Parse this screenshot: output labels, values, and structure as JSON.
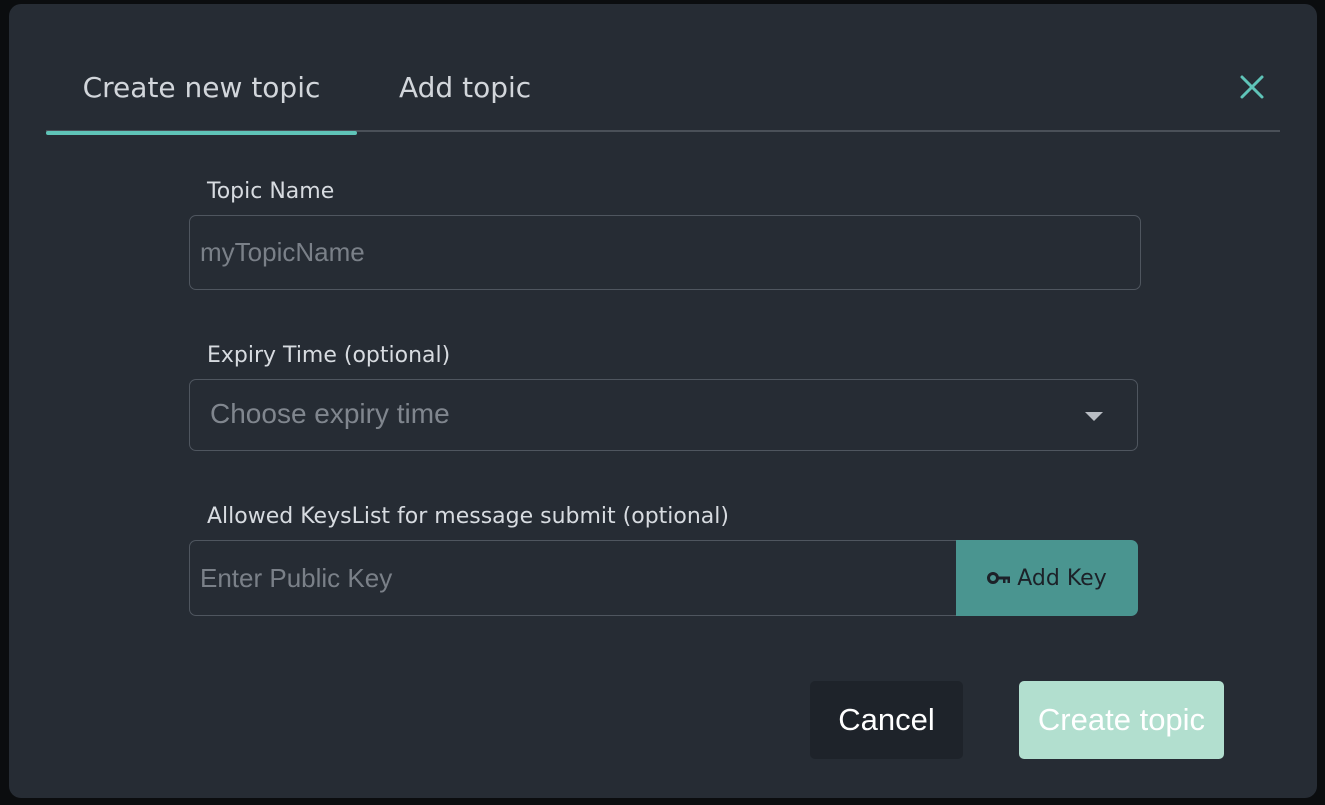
{
  "tabs": [
    {
      "label": "Create new topic",
      "active": true
    },
    {
      "label": "Add topic",
      "active": false
    }
  ],
  "topic_name": {
    "label": "Topic Name",
    "placeholder": "myTopicName",
    "value": ""
  },
  "expiry": {
    "label": "Expiry Time (optional)",
    "placeholder": "Choose expiry time"
  },
  "keys": {
    "label": "Allowed KeysList for message submit (optional)",
    "placeholder": "Enter Public Key",
    "add_button_label": "Add Key",
    "add_button_icon": "key-icon"
  },
  "actions": {
    "cancel_label": "Cancel",
    "create_label": "Create topic"
  },
  "colors": {
    "dialog_bg": "#262c34",
    "accent": "#5fc4b8",
    "add_key_button": "#4a9590",
    "create_button": "#b2dfcf",
    "cancel_button": "#1e232a"
  }
}
